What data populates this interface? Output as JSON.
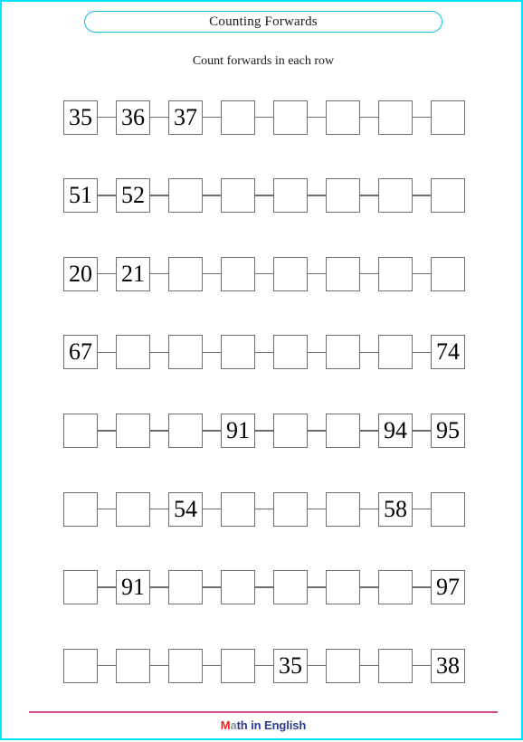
{
  "title": "Counting Forwards",
  "instruction": "Count forwards in each row",
  "colors": {
    "page_border": "#00e5ff",
    "title_border": "#14bfe4",
    "box_border": "#6e6e6e",
    "footer_rule": "#d4498b",
    "logo_m": "#ee2222",
    "logo_a": "#8a9199",
    "logo_rest": "#2a3b8f"
  },
  "footer": {
    "logo_m": "M",
    "logo_a": "a",
    "logo_rest": "th in English"
  },
  "rows": [
    {
      "cells": [
        "35",
        "36",
        "37",
        "",
        "",
        "",
        "",
        ""
      ]
    },
    {
      "cells": [
        "51",
        "52",
        "",
        "",
        "",
        "",
        "",
        ""
      ]
    },
    {
      "cells": [
        "20",
        "21",
        "",
        "",
        "",
        "",
        "",
        ""
      ]
    },
    {
      "cells": [
        "67",
        "",
        "",
        "",
        "",
        "",
        "",
        "74"
      ]
    },
    {
      "cells": [
        "",
        "",
        "",
        "91",
        "",
        "",
        "94",
        "95"
      ]
    },
    {
      "cells": [
        "",
        "",
        "54",
        "",
        "",
        "",
        "58",
        ""
      ]
    },
    {
      "cells": [
        "",
        "91",
        "",
        "",
        "",
        "",
        "",
        "97"
      ]
    },
    {
      "cells": [
        "",
        "",
        "",
        "",
        "35",
        "",
        "",
        "38"
      ]
    }
  ]
}
